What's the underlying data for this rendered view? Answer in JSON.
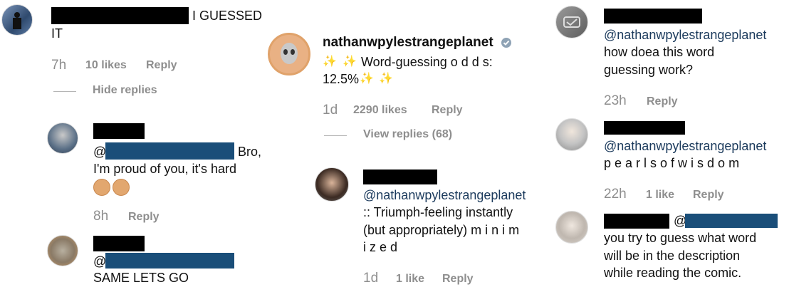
{
  "col1": {
    "c1": {
      "text_suffix": "I GUESSED",
      "text_line2": "IT",
      "time": "7h",
      "likes": "10 likes",
      "reply": "Reply",
      "hide_replies": "Hide replies"
    },
    "c2": {
      "at": "@",
      "text_suffix": "Bro,",
      "text_line2": "I'm proud of you, it's hard",
      "time": "8h",
      "reply": "Reply"
    },
    "c3": {
      "at": "@",
      "text": "SAME LETS GO"
    }
  },
  "col2": {
    "post": {
      "username": "nathanwpylestrangeplanet",
      "sparkle": "✨",
      "line1": "Word-guessing o d d s:",
      "line2": "12.5%",
      "time": "1d",
      "likes": "2290 likes",
      "reply": "Reply",
      "view_replies": "View replies (68)"
    },
    "c1": {
      "mention": "@nathanwpylestrangeplanet",
      "line1": ":: Triumph-feeling instantly",
      "line2": "(but appropriately) m i n i m",
      "line3": "i z e d",
      "time": "1d",
      "likes": "1 like",
      "reply": "Reply"
    }
  },
  "col3": {
    "c1": {
      "mention": "@nathanwpylestrangeplanet",
      "line1": "how doea this word",
      "line2": "guessing work?",
      "time": "23h",
      "reply": "Reply"
    },
    "c2": {
      "mention": "@nathanwpylestrangeplanet",
      "line1": "p e a r l s o f w i s d o m",
      "time": "22h",
      "likes": "1 like",
      "reply": "Reply"
    },
    "c3": {
      "at": "@",
      "line1": "you try to guess what word",
      "line2": "will be in the description",
      "line3": "while reading the comic."
    }
  },
  "colors": {
    "muted": "#8e8e8e",
    "mention": "#1b3a5c",
    "redaction": "#000000",
    "mention_redaction": "#1a4e79",
    "verified": "#3897f0"
  }
}
